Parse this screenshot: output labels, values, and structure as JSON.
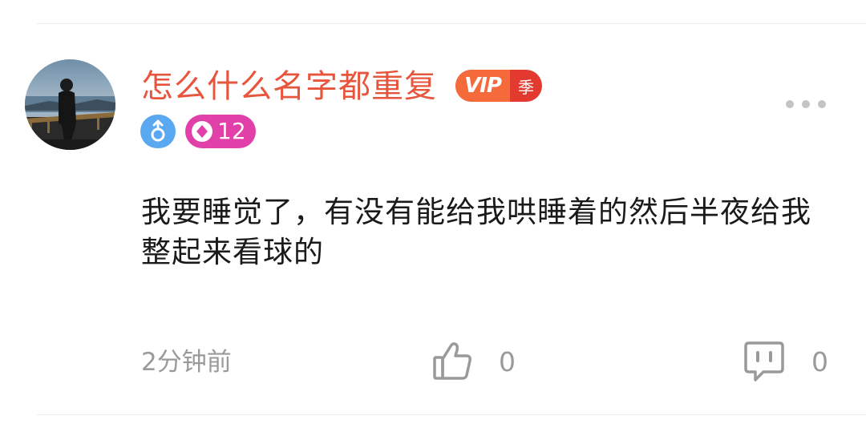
{
  "comment": {
    "author": {
      "name": "怎么什么名字都重复",
      "avatar_icon": "profile-photo",
      "vip_label": "VIP",
      "vip_season_label": "季",
      "gender_icon": "male-icon",
      "level_icon": "diamond-icon",
      "level": "12"
    },
    "text": "我要睡觉了，有没有能给我哄睡着的然后半夜给我整起来看球的",
    "timestamp": "2分钟前",
    "like_icon": "thumbs-up-icon",
    "like_count": "0",
    "reply_icon": "comment-bubble-icon",
    "reply_count": "0",
    "more_icon": "more-dots-icon"
  },
  "colors": {
    "username": "#e8553d",
    "vip_orange": "#f56a3a",
    "vip_red": "#e33a2f",
    "gender_blue": "#5aa8f0",
    "level_pink": "#e040a8",
    "muted_gray": "#9a9a9a"
  }
}
